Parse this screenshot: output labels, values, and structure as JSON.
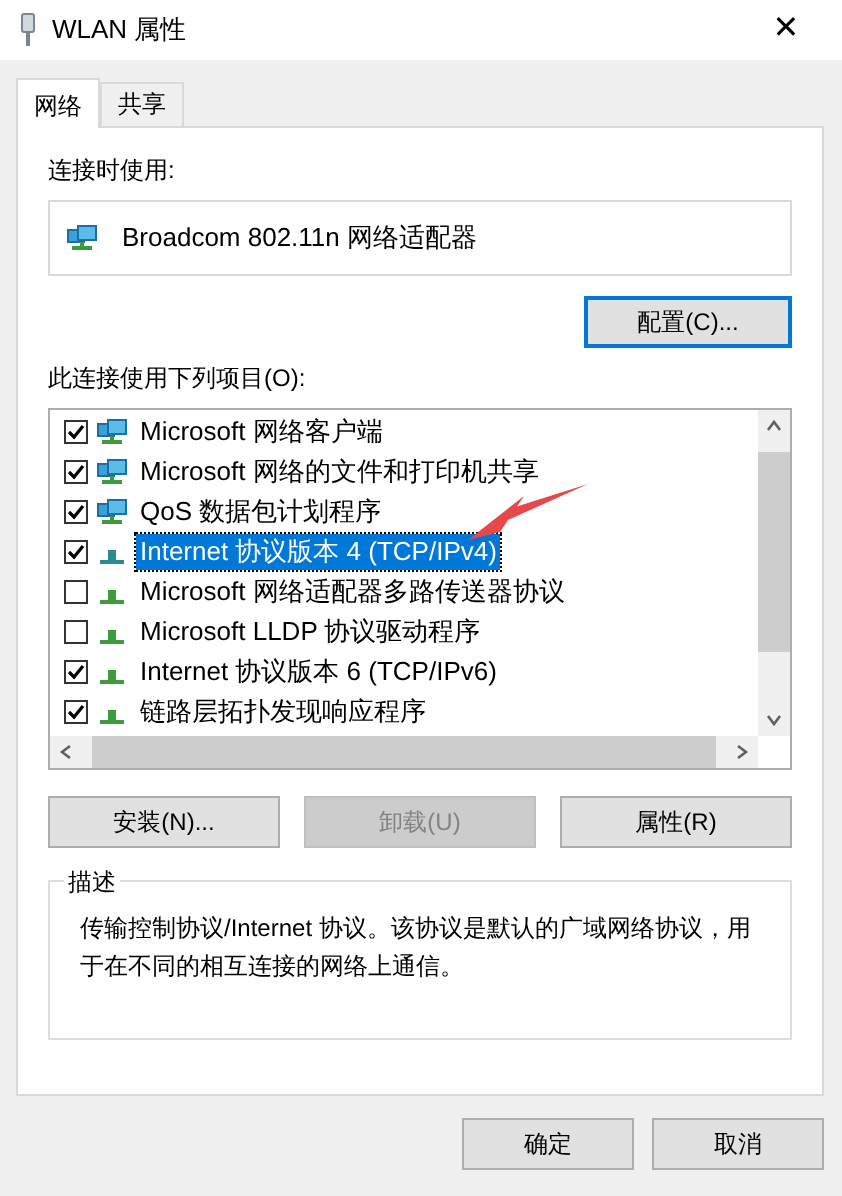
{
  "window": {
    "title": "WLAN 属性",
    "close": "✕"
  },
  "tabs": [
    {
      "label": "网络",
      "selected": true
    },
    {
      "label": "共享",
      "selected": false
    }
  ],
  "connect_using": {
    "label": "连接时使用:",
    "adapter": "Broadcom 802.11n 网络适配器"
  },
  "configure_button": {
    "label": "配置(C)...",
    "focused": true,
    "disabled": false
  },
  "items_label": "此连接使用下列项目(O):",
  "items": [
    {
      "kind": "client",
      "label": "Microsoft 网络客户端",
      "checked": true,
      "selected": false
    },
    {
      "kind": "service",
      "label": "Microsoft 网络的文件和打印机共享",
      "checked": true,
      "selected": false
    },
    {
      "kind": "service",
      "label": "QoS 数据包计划程序",
      "checked": true,
      "selected": false
    },
    {
      "kind": "protocol",
      "label": "Internet 协议版本 4 (TCP/IPv4)",
      "checked": true,
      "selected": true
    },
    {
      "kind": "protocol",
      "label": "Microsoft 网络适配器多路传送器协议",
      "checked": false,
      "selected": false
    },
    {
      "kind": "protocol",
      "label": "Microsoft LLDP 协议驱动程序",
      "checked": false,
      "selected": false
    },
    {
      "kind": "protocol",
      "label": "Internet 协议版本 6 (TCP/IPv6)",
      "checked": true,
      "selected": false
    },
    {
      "kind": "protocol",
      "label": "链路层拓扑发现响应程序",
      "checked": true,
      "selected": false
    }
  ],
  "item_buttons": [
    {
      "label": "安装(N)...",
      "disabled": false,
      "focused": false
    },
    {
      "label": "卸载(U)",
      "disabled": true,
      "focused": false
    },
    {
      "label": "属性(R)",
      "disabled": false,
      "focused": false
    }
  ],
  "description": {
    "title": "描述",
    "text": "传输控制协议/Internet 协议。该协议是默认的广域网络协议，用于在不同的相互连接的网络上通信。"
  },
  "dialog_buttons": [
    {
      "label": "确定",
      "disabled": false,
      "focused": false
    },
    {
      "label": "取消",
      "disabled": false,
      "focused": false
    }
  ]
}
